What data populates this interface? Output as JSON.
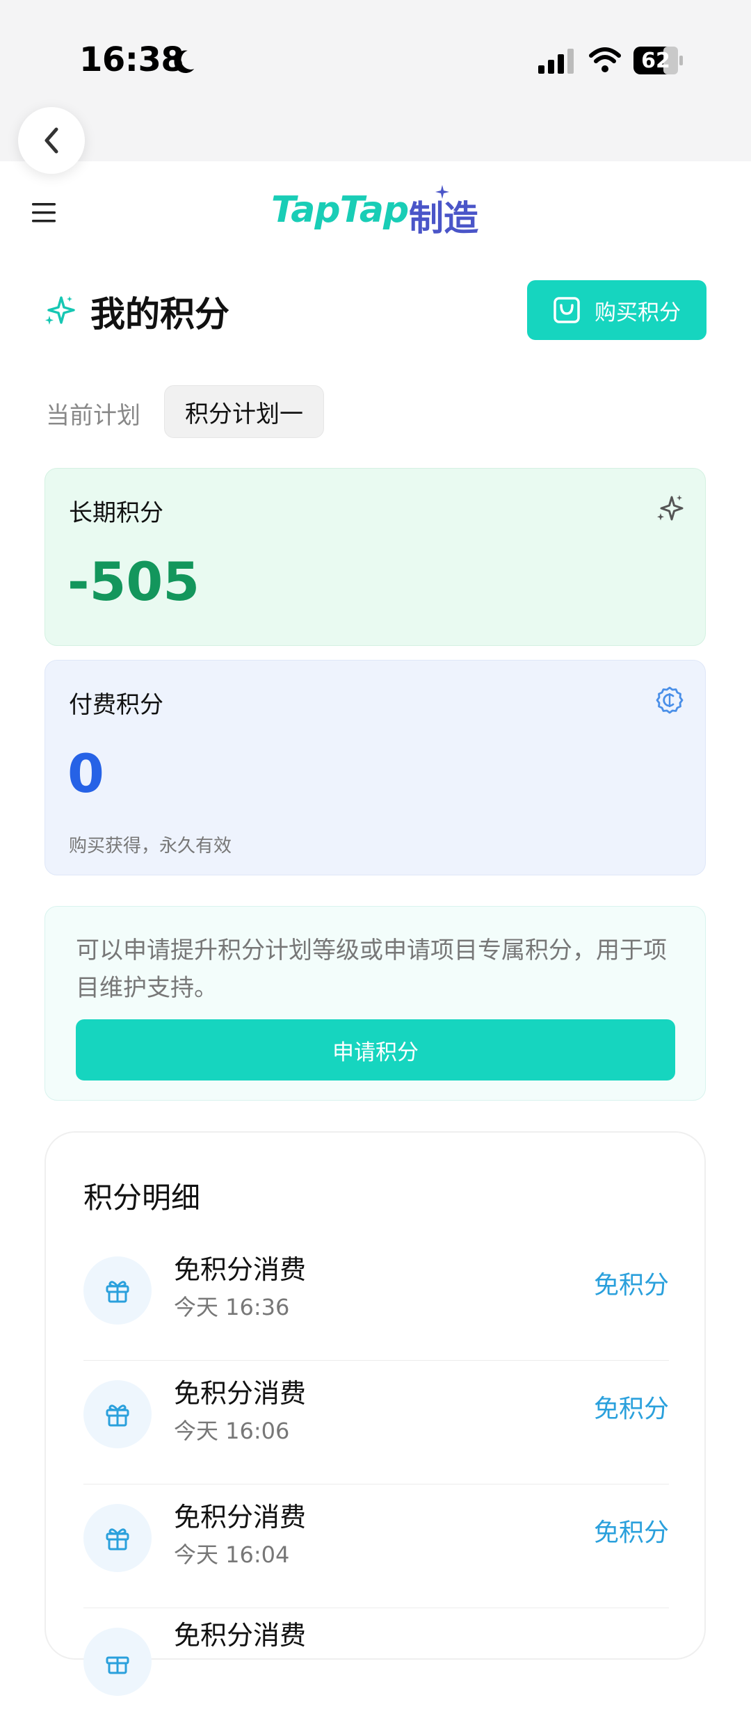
{
  "status_bar": {
    "time": "16:38",
    "battery": "62"
  },
  "header": {
    "logo_text_en": "TapTap",
    "logo_text_cn": "制造"
  },
  "page": {
    "title": "我的积分",
    "buy_button": "购买积分",
    "plan_label": "当前计划",
    "plan_value": "积分计划一"
  },
  "cards": {
    "long_term": {
      "label": "长期积分",
      "value": "-505"
    },
    "paid": {
      "label": "付费积分",
      "value": "0",
      "note": "购买获得，永久有效"
    }
  },
  "apply": {
    "text": "可以申请提升积分计划等级或申请项目专属积分，用于项目维护支持。",
    "button": "申请积分"
  },
  "details": {
    "title": "积分明细",
    "rows": [
      {
        "title": "免积分消费",
        "time": "今天 16:36",
        "amount": "免积分"
      },
      {
        "title": "免积分消费",
        "time": "今天 16:06",
        "amount": "免积分"
      },
      {
        "title": "免积分消费",
        "time": "今天 16:04",
        "amount": "免积分"
      },
      {
        "title": "免积分消费",
        "time": "",
        "amount": ""
      }
    ]
  },
  "colors": {
    "accent": "#16d5bf",
    "long_term_value": "#13965c",
    "paid_value": "#2662e6",
    "amount": "#2aa0dc"
  }
}
